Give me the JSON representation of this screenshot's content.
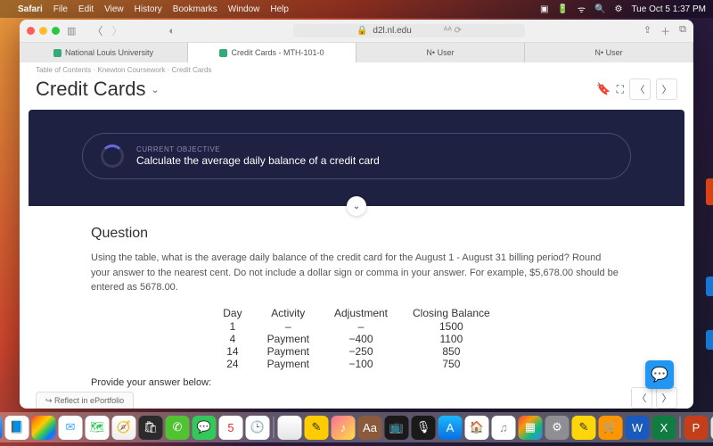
{
  "menubar": {
    "app": "Safari",
    "items": [
      "File",
      "Edit",
      "View",
      "History",
      "Bookmarks",
      "Window",
      "Help"
    ],
    "clock": "Tue Oct 5  1:37 PM"
  },
  "browser": {
    "url": "d2l.nl.edu",
    "lock": "🔒",
    "tabs": [
      {
        "label": "National Louis University"
      },
      {
        "label": "Credit Cards - MTH-101-0"
      },
      {
        "label": "N• User"
      },
      {
        "label": "N• User"
      }
    ]
  },
  "page": {
    "crumbs": "Table of Contents  ·  Knewton Coursework  ·  Credit Cards",
    "title": "Credit Cards",
    "objective_label": "CURRENT OBJECTIVE",
    "objective_text": "Calculate the average daily balance of a credit card",
    "question_heading": "Question",
    "question_text": "Using the table, what is the average daily balance of the credit card for the August 1 - August 31 billing period? Round your answer to the nearest cent. Do not include a dollar sign or comma in your answer. For example, $5,678.00 should be entered as 5678.00.",
    "table": {
      "headers": [
        "Day",
        "Activity",
        "Adjustment",
        "Closing Balance"
      ],
      "rows": [
        [
          "1",
          "–",
          "–",
          "1500"
        ],
        [
          "4",
          "Payment",
          "−400",
          "1100"
        ],
        [
          "14",
          "Payment",
          "−250",
          "850"
        ],
        [
          "24",
          "Payment",
          "−100",
          "750"
        ]
      ]
    },
    "provide": "Provide your answer below:",
    "reflect": "↪ Reflect in ePortfolio"
  },
  "dock": [
    {
      "bg": "linear-gradient(180deg,#3ba7ff,#0a6ee0)",
      "t": "☻"
    },
    {
      "bg": "#fff",
      "t": "📘",
      "c": "#0a6ee0"
    },
    {
      "bg": "linear-gradient(135deg,#ff2d55,#ff9500,#ffcc00,#34c759,#007aff,#af52de)",
      "t": ""
    },
    {
      "bg": "#fff",
      "t": "✉︎",
      "c": "#3ba7ff"
    },
    {
      "bg": "#fff",
      "t": "🗺",
      "c": "#34c759"
    },
    {
      "bg": "linear-gradient(180deg,#fff,#eee)",
      "t": "🧭"
    },
    {
      "bg": "#2b2b2b",
      "t": "🛍"
    },
    {
      "bg": "#51c332",
      "t": "✆"
    },
    {
      "bg": "#34c759",
      "t": "💬"
    },
    {
      "bg": "#fff",
      "t": "5",
      "c": "#e03131"
    },
    {
      "bg": "#fff",
      "t": "🕒"
    },
    {
      "bg": "linear-gradient(180deg,#fff,#e5e5e5)",
      "t": ""
    },
    {
      "bg": "#ffcc00",
      "t": "✎",
      "c": "#333"
    },
    {
      "bg": "linear-gradient(135deg,#fa709a,#fee140)",
      "t": "♪"
    },
    {
      "bg": "#8b5a3c",
      "t": "Aa"
    },
    {
      "bg": "#1a1a1a",
      "t": "📺"
    },
    {
      "bg": "#1a1a1a",
      "t": "🎙"
    },
    {
      "bg": "linear-gradient(180deg,#1db7ff,#0a6ee0)",
      "t": "A",
      "c": "#fff"
    },
    {
      "bg": "#fff",
      "t": "🏠",
      "c": "#ff3b30"
    },
    {
      "bg": "#fff",
      "t": "♫",
      "c": "#888"
    },
    {
      "bg": "linear-gradient(135deg,#ef4444,#f59e0b,#10b981,#3b82f6)",
      "t": "▦"
    },
    {
      "bg": "#8e8e93",
      "t": "⚙︎"
    },
    {
      "bg": "#ffd60a",
      "t": "✎",
      "c": "#333"
    },
    {
      "bg": "#ff9500",
      "t": "🛒"
    },
    {
      "bg": "#185abd",
      "t": "W"
    },
    {
      "bg": "#107c41",
      "t": "X"
    },
    {
      "bg": "#c43e1c",
      "t": "P"
    },
    {
      "bg": "#e5e5e5",
      "t": "🗑",
      "c": "#555"
    }
  ]
}
